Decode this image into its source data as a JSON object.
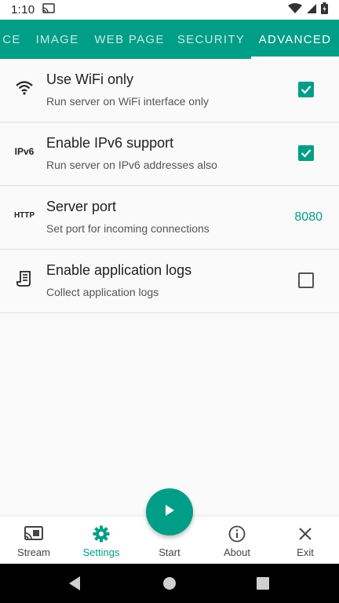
{
  "status_bar": {
    "time": "1:10",
    "icons": [
      "cast-icon",
      "wifi-icon",
      "signal-icon",
      "battery-icon"
    ]
  },
  "tabs": {
    "items": [
      "CE",
      "IMAGE",
      "WEB PAGE",
      "SECURITY",
      "ADVANCED"
    ],
    "active": "ADVANCED"
  },
  "settings": [
    {
      "icon": "wifi-icon",
      "title": "Use WiFi only",
      "subtitle": "Run server on WiFi interface only",
      "control": "checkbox",
      "checked": true
    },
    {
      "icon": "ipv6-icon",
      "icon_text": "IPv6",
      "title": "Enable IPv6 support",
      "subtitle": "Run server on IPv6 addresses also",
      "control": "checkbox",
      "checked": true
    },
    {
      "icon": "http-icon",
      "icon_text": "HTTP",
      "title": "Server port",
      "subtitle": "Set port for incoming connections",
      "control": "value",
      "value": "8080"
    },
    {
      "icon": "log-icon",
      "title": "Enable application logs",
      "subtitle": "Collect application logs",
      "control": "checkbox",
      "checked": false
    }
  ],
  "bottom_nav": {
    "items": [
      {
        "label": "Stream",
        "icon": "cast-screen-icon"
      },
      {
        "label": "Settings",
        "icon": "gear-icon"
      },
      {
        "label": "Start",
        "icon": "play-icon"
      },
      {
        "label": "About",
        "icon": "info-icon"
      },
      {
        "label": "Exit",
        "icon": "close-icon"
      }
    ],
    "active": "Settings"
  },
  "colors": {
    "accent": "#009e87",
    "background": "#fafafa",
    "nav_bar": "#000000"
  }
}
